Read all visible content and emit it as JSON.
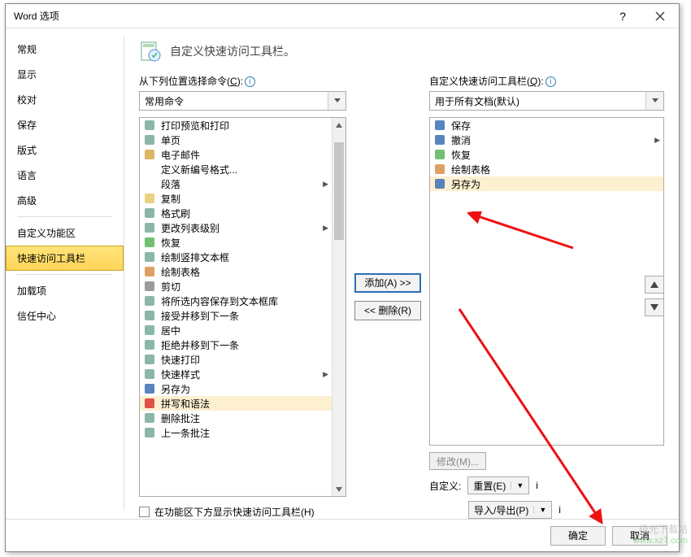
{
  "titlebar": {
    "title": "Word 选项"
  },
  "sidebar": {
    "items": [
      {
        "label": "常规"
      },
      {
        "label": "显示"
      },
      {
        "label": "校对"
      },
      {
        "label": "保存"
      },
      {
        "label": "版式"
      },
      {
        "label": "语言"
      },
      {
        "label": "高级"
      },
      {
        "label": "自定义功能区"
      },
      {
        "label": "快速访问工具栏",
        "selected": true
      },
      {
        "label": "加载项"
      },
      {
        "label": "信任中心"
      }
    ]
  },
  "header": {
    "title": "自定义快速访问工具栏。"
  },
  "left": {
    "label": "从下列位置选择命令",
    "label_key": "C",
    "select": "常用命令",
    "items": [
      {
        "label": "打印预览和打印",
        "icon": "print-preview"
      },
      {
        "label": "单页",
        "icon": "single-page"
      },
      {
        "label": "电子邮件",
        "icon": "email"
      },
      {
        "label": "定义新编号格式...",
        "icon": ""
      },
      {
        "label": "段落",
        "icon": "",
        "submenu": true
      },
      {
        "label": "复制",
        "icon": "copy"
      },
      {
        "label": "格式刷",
        "icon": "format-painter"
      },
      {
        "label": "更改列表级别",
        "icon": "list-level",
        "submenu": true
      },
      {
        "label": "恢复",
        "icon": "redo"
      },
      {
        "label": "绘制竖排文本框",
        "icon": "vtextbox"
      },
      {
        "label": "绘制表格",
        "icon": "draw-table"
      },
      {
        "label": "剪切",
        "icon": "cut"
      },
      {
        "label": "将所选内容保存到文本框库",
        "icon": "save-selection"
      },
      {
        "label": "接受并移到下一条",
        "icon": "accept-next"
      },
      {
        "label": "居中",
        "icon": "center"
      },
      {
        "label": "拒绝并移到下一条",
        "icon": "reject-next"
      },
      {
        "label": "快速打印",
        "icon": "quick-print"
      },
      {
        "label": "快速样式",
        "icon": "quick-styles",
        "submenu": true
      },
      {
        "label": "另存为",
        "icon": "save-as"
      },
      {
        "label": "拼写和语法",
        "icon": "spelling",
        "selected": true
      },
      {
        "label": "删除批注",
        "icon": "delete-comment"
      },
      {
        "label": "上一条批注",
        "icon": "prev-comment"
      }
    ]
  },
  "mid": {
    "add": "添加(A) >>",
    "remove": "<< 删除(R)"
  },
  "right": {
    "label": "自定义快速访问工具栏",
    "label_key": "Q",
    "select": "用于所有文档(默认)",
    "items": [
      {
        "label": "保存",
        "icon": "save"
      },
      {
        "label": "撤消",
        "icon": "undo",
        "submenu": true
      },
      {
        "label": "恢复",
        "icon": "redo"
      },
      {
        "label": "绘制表格",
        "icon": "draw-table"
      },
      {
        "label": "另存为",
        "icon": "save-as",
        "selected": true
      }
    ],
    "modify": "修改(M)...",
    "custom_label": "自定义:",
    "reset": "重置(E)",
    "importexport": "导入/导出(P)"
  },
  "checkbox": {
    "label": "在功能区下方显示快速访问工具栏(H)"
  },
  "footer": {
    "ok": "确定",
    "cancel": "取消"
  },
  "watermark": {
    "l1": "极光下载站",
    "l2": "www.xz7.com"
  }
}
